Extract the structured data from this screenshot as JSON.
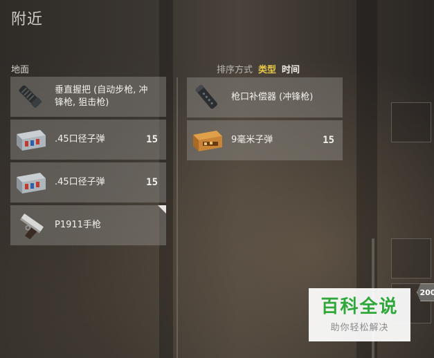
{
  "title": "附近",
  "ground_label": "地面",
  "sort": {
    "prefix": "排序方式",
    "options": [
      {
        "label": "类型",
        "active": true
      },
      {
        "label": "时间",
        "active": false
      }
    ]
  },
  "ground_items": [
    {
      "name": "垂直握把 (自动步枪, 冲锋枪, 狙击枪)",
      "count": "",
      "icon": "vertical-grip-icon"
    },
    {
      "name": ".45口径子弹",
      "count": "15",
      "icon": "45-ammo-box-icon"
    },
    {
      "name": ".45口径子弹",
      "count": "15",
      "icon": "45-ammo-box-icon"
    },
    {
      "name": "P1911手枪",
      "count": "",
      "icon": "p1911-pistol-icon"
    }
  ],
  "inventory_items": [
    {
      "name": "枪口补偿器 (冲锋枪)",
      "count": "",
      "icon": "compensator-icon"
    },
    {
      "name": "9毫米子弹",
      "count": "15",
      "icon": "9mm-ammo-box-icon"
    }
  ],
  "badge": "200",
  "watermark": {
    "title": "百科全说",
    "subtitle": "助你轻松解决"
  },
  "colors": {
    "active_sort": "#e8c84a",
    "panel": "#96948e",
    "watermark_green": "#2fa83a"
  }
}
